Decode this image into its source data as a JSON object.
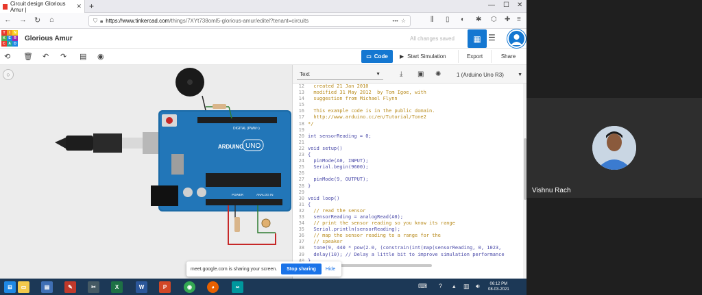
{
  "browser": {
    "tab_title": "Circuit design Glorious Amur |",
    "url_domain": "https://www.tinkercad.com",
    "url_path": "/things/7XYt738oml5-glorious-amur/editel?tenant=circuits"
  },
  "app": {
    "logo_letters": [
      "T",
      "I",
      "N",
      "K",
      "E",
      "R",
      "C",
      "A",
      "D"
    ],
    "logo_colors": [
      "#e8392c",
      "#f39a1b",
      "#f9d01e",
      "#4caf50",
      "#1e88e5",
      "#9c27b0",
      "#e8392c",
      "#26a69a",
      "#1e88e5"
    ],
    "design_name": "Glorious Amur",
    "save_status": "All changes saved"
  },
  "toolbar": {
    "code_label": "Code",
    "simulate_label": "Start Simulation",
    "export_label": "Export",
    "share_label": "Share"
  },
  "board": {
    "labels": {
      "digital": "DIGITAL (PWM~)",
      "brand": "ARDUINO",
      "model": "UNO",
      "power": "POWER",
      "analog": "ANALOG IN"
    }
  },
  "code_panel": {
    "mode": "Text",
    "board_select": "1 (Arduino Uno R3)",
    "lines": [
      {
        "n": "12",
        "t": "  created 21 Jan 2010",
        "c": true
      },
      {
        "n": "13",
        "t": "  modified 31 May 2012  by Tom Igoe, with",
        "c": true
      },
      {
        "n": "14",
        "t": "  suggestion from Michael Flynn",
        "c": true
      },
      {
        "n": "15",
        "t": "",
        "c": true
      },
      {
        "n": "16",
        "t": "  This example code is in the public domain.",
        "c": true
      },
      {
        "n": "17",
        "t": "  http://www.arduino.cc/en/Tutorial/Tone2",
        "c": true
      },
      {
        "n": "18",
        "t": "*/",
        "c": true
      },
      {
        "n": "19",
        "t": "",
        "c": false
      },
      {
        "n": "20",
        "t": "int sensorReading = 0;",
        "c": false
      },
      {
        "n": "21",
        "t": "",
        "c": false
      },
      {
        "n": "22",
        "t": "void setup()",
        "c": false
      },
      {
        "n": "23",
        "t": "{",
        "c": false
      },
      {
        "n": "24",
        "t": "  pinMode(A0, INPUT);",
        "c": false
      },
      {
        "n": "25",
        "t": "  Serial.begin(9600);",
        "c": false
      },
      {
        "n": "26",
        "t": "",
        "c": false
      },
      {
        "n": "27",
        "t": "  pinMode(9, OUTPUT);",
        "c": false
      },
      {
        "n": "28",
        "t": "}",
        "c": false
      },
      {
        "n": "29",
        "t": "",
        "c": false
      },
      {
        "n": "30",
        "t": "void loop()",
        "c": false
      },
      {
        "n": "31",
        "t": "{",
        "c": false
      },
      {
        "n": "32",
        "t": "  // read the sensor",
        "c": true
      },
      {
        "n": "33",
        "t": "  sensorReading = analogRead(A0);",
        "c": false
      },
      {
        "n": "34",
        "t": "  // print the sensor reading so you know its range",
        "c": true
      },
      {
        "n": "35",
        "t": "  Serial.println(sensorReading);",
        "c": false
      },
      {
        "n": "36",
        "t": "  // map the sensor reading to a range for the",
        "c": true
      },
      {
        "n": "37",
        "t": "  // speaker",
        "c": true
      },
      {
        "n": "38",
        "t": "  tone(9, 440 * pow(2.0, (constrain(int(map(sensorReading, 0, 1023,",
        "c": false
      },
      {
        "n": "39",
        "t": "  delay(10); // Delay a little bit to improve simulation performance",
        "c": false
      },
      {
        "n": "40",
        "t": "}",
        "c": false
      }
    ]
  },
  "share_banner": {
    "text": "meet.google.com is sharing your screen.",
    "stop_label": "Stop sharing",
    "hide_label": "Hide"
  },
  "taskbar": {
    "time": "06:12 PM",
    "date": "08-03-2021"
  },
  "participant": {
    "name": "Vishnu Rach"
  }
}
